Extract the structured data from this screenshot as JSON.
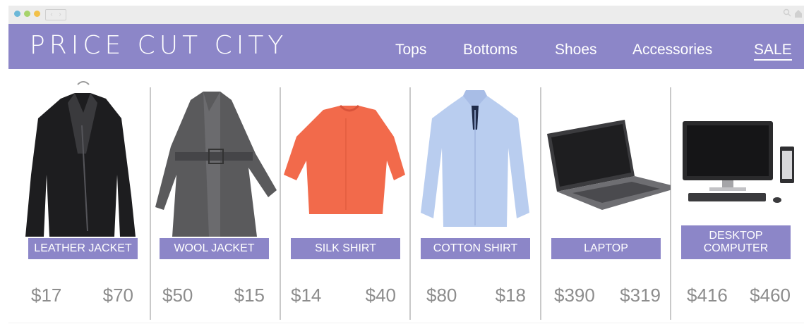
{
  "browser": {
    "nav_left": "‹",
    "nav_right": "›"
  },
  "site": {
    "brand": "PRICE CUT CITY",
    "nav": [
      "Tops",
      "Bottoms",
      "Shoes",
      "Accessories",
      "SALE"
    ]
  },
  "colors": {
    "header": "#8c86c8",
    "price": "#8d8d8d",
    "divider": "#c9c9c9"
  },
  "products": [
    {
      "name": "LEATHER JACKET",
      "price_a": "$17",
      "price_b": "$70"
    },
    {
      "name": "WOOL JACKET",
      "price_a": "$50",
      "price_b": "$15"
    },
    {
      "name": "SILK SHIRT",
      "price_a": "$14",
      "price_b": "$40"
    },
    {
      "name": "COTTON SHIRT",
      "price_a": "$80",
      "price_b": "$18"
    },
    {
      "name": "LAPTOP",
      "price_a": "$390",
      "price_b": "$319"
    },
    {
      "name": "DESKTOP COMPUTER",
      "price_a": "$416",
      "price_b": "$460"
    }
  ],
  "icons": [
    "search-icon",
    "home-icon",
    "leather-jacket-image",
    "wool-jacket-image",
    "silk-shirt-image",
    "cotton-shirt-image",
    "laptop-image",
    "desktop-computer-image"
  ]
}
